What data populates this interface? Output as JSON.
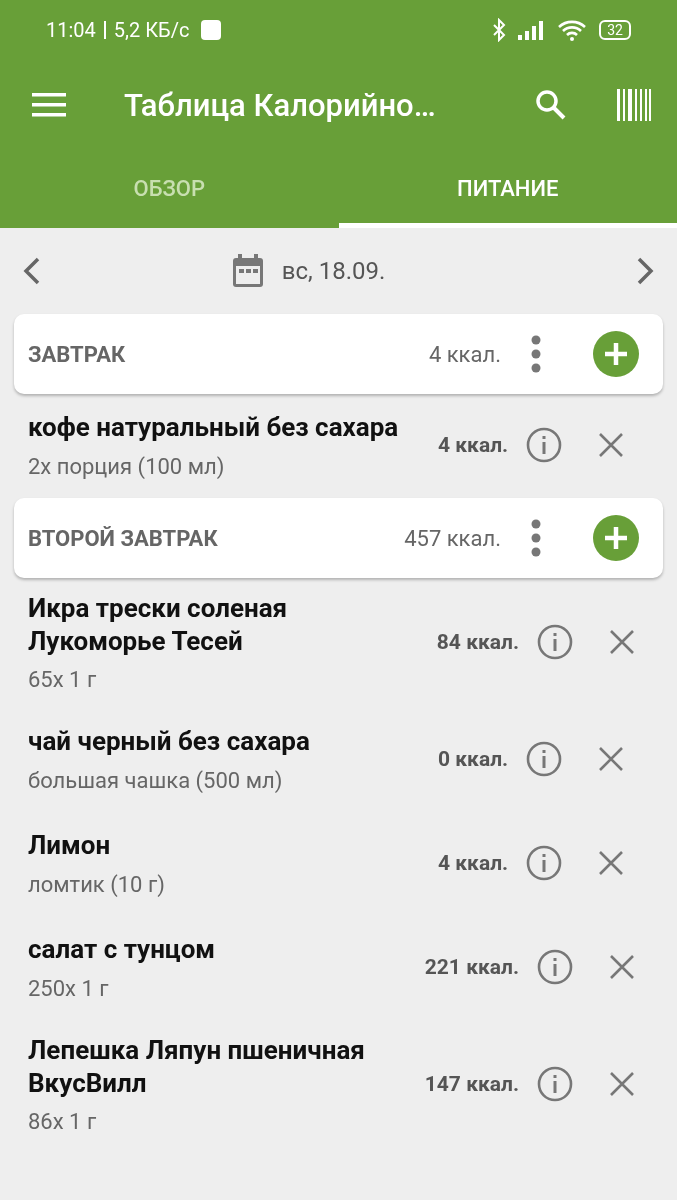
{
  "status_bar": {
    "time": "11:04",
    "speed": "5,2 КБ/с",
    "battery": "32"
  },
  "app_bar": {
    "title": "Таблица Калорийно…"
  },
  "tabs": [
    {
      "label": "ОБЗОР",
      "selected": false
    },
    {
      "label": "ПИТАНИЕ",
      "selected": true
    }
  ],
  "date": "вс, 18.09.",
  "meals": [
    {
      "title": "ЗАВТРАК",
      "kcal": "4 ккал.",
      "items": [
        {
          "name": "кофе натуральный без сахара",
          "portion": "2x порция (100 мл)",
          "kcal": "4 ккал."
        }
      ]
    },
    {
      "title": "ВТОРОЙ ЗАВТРАК",
      "kcal": "457 ккал.",
      "items": [
        {
          "name": "Икра трески соленая Лукоморье Тесей",
          "portion": "65x 1 г",
          "kcal": "84 ккал."
        },
        {
          "name": "чай черный без сахара",
          "portion": "большая чашка (500 мл)",
          "kcal": "0 ккал."
        },
        {
          "name": "Лимон",
          "portion": "ломтик (10 г)",
          "kcal": "4 ккал."
        },
        {
          "name": "салат с тунцом",
          "portion": "250x 1 г",
          "kcal": "221 ккал."
        },
        {
          "name": "Лепешка Ляпун пшеничная ВкусВилл",
          "portion": "86x 1 г",
          "kcal": "147 ккал."
        }
      ]
    }
  ]
}
